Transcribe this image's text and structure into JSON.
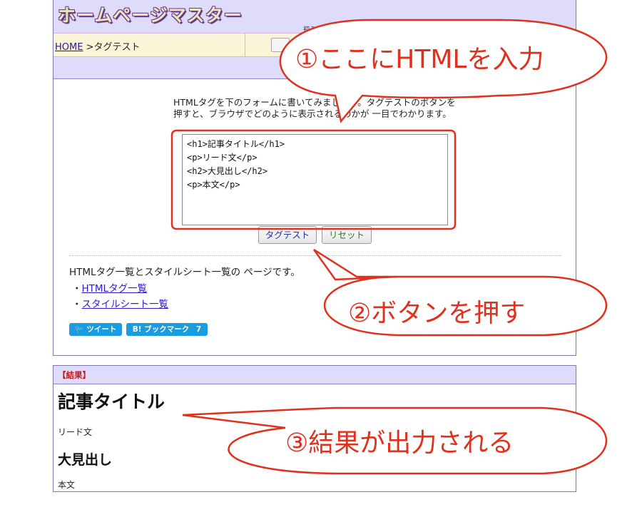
{
  "header": {
    "logo": "ホームページマスター",
    "small_text": "初ミ"
  },
  "breadcrumb": {
    "home": "HOME",
    "current": " >タグテスト"
  },
  "intro_text": "HTMLタグを下のフォームに書いてみましょう。タグテストのボタンを押すと、ブラウザでどのように表示されるのかが 一目でわかります。",
  "textarea_value": "<h1>記事タイトル</h1>\n<p>リード文</p>\n<h2>大見出し</h2>\n<p>本文</p>",
  "buttons": {
    "test": "タグテスト",
    "reset": "リセット"
  },
  "links": {
    "intro": "HTMLタグ一覧とスタイルシート一覧の ページです。",
    "bullet": "・",
    "tag_list": "HTMLタグ一覧",
    "style_list": "スタイルシート一覧"
  },
  "share": {
    "tweet": "ツイート",
    "bookmark": "B! ブックマーク",
    "bookmark_count": "7"
  },
  "result": {
    "label": "【結果】",
    "h1": "記事タイトル",
    "p1": "リード文",
    "h2": "大見出し",
    "p2": "本文"
  },
  "callouts": {
    "c1": "①ここにHTMLを入力",
    "c2": "②ボタンを押す",
    "c3": "③結果が出力される"
  },
  "colors": {
    "callout_red": "#e0301e",
    "header_lavender": "#dfdcfb",
    "link_blue": "#2a1ad0",
    "share_blue": "#1b9be0"
  }
}
